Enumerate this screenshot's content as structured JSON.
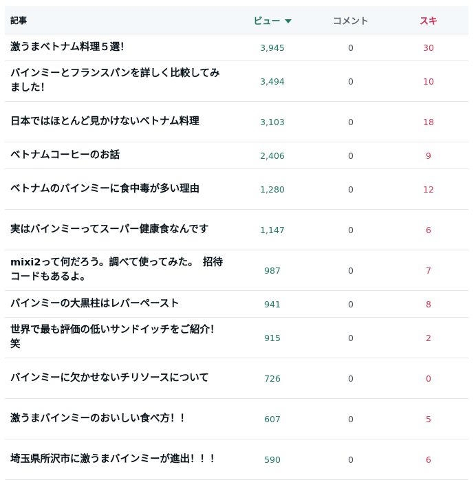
{
  "header": {
    "title": "記事",
    "views": "ビュー",
    "comments": "コメント",
    "likes": "スキ"
  },
  "rows": [
    {
      "title": "激うまベトナム料理５選！",
      "views": "3,945",
      "comments": "0",
      "likes": "30"
    },
    {
      "title": "バインミーとフランスパンを詳しく比較してみました！",
      "views": "3,494",
      "comments": "0",
      "likes": "10"
    },
    {
      "title": "日本ではほとんど見かけないベトナム料理",
      "views": "3,103",
      "comments": "0",
      "likes": "18"
    },
    {
      "title": "ベトナムコーヒーのお話",
      "views": "2,406",
      "comments": "0",
      "likes": "9"
    },
    {
      "title": "ベトナムのバインミーに食中毒が多い理由",
      "views": "1,280",
      "comments": "0",
      "likes": "12"
    },
    {
      "title": "実はバインミーってスーパー健康食なんです",
      "views": "1,147",
      "comments": "0",
      "likes": "6"
    },
    {
      "title": "mixi2って何だろう。調べて使ってみた。　招待コードもあるよ。",
      "views": "987",
      "comments": "0",
      "likes": "7"
    },
    {
      "title": "バインミーの大黒柱はレバーペースト",
      "views": "941",
      "comments": "0",
      "likes": "8"
    },
    {
      "title": "世界で最も評価の低いサンドイッチをご紹介！笑",
      "views": "915",
      "comments": "0",
      "likes": "2"
    },
    {
      "title": "バインミーに欠かせないチリソースについて",
      "views": "726",
      "comments": "0",
      "likes": "0"
    },
    {
      "title": "激うまバインミーのおいしい食べ方！！",
      "views": "607",
      "comments": "0",
      "likes": "5"
    },
    {
      "title": "埼玉県所沢市に激うまバインミーが進出！！！",
      "views": "590",
      "comments": "0",
      "likes": "6"
    }
  ]
}
